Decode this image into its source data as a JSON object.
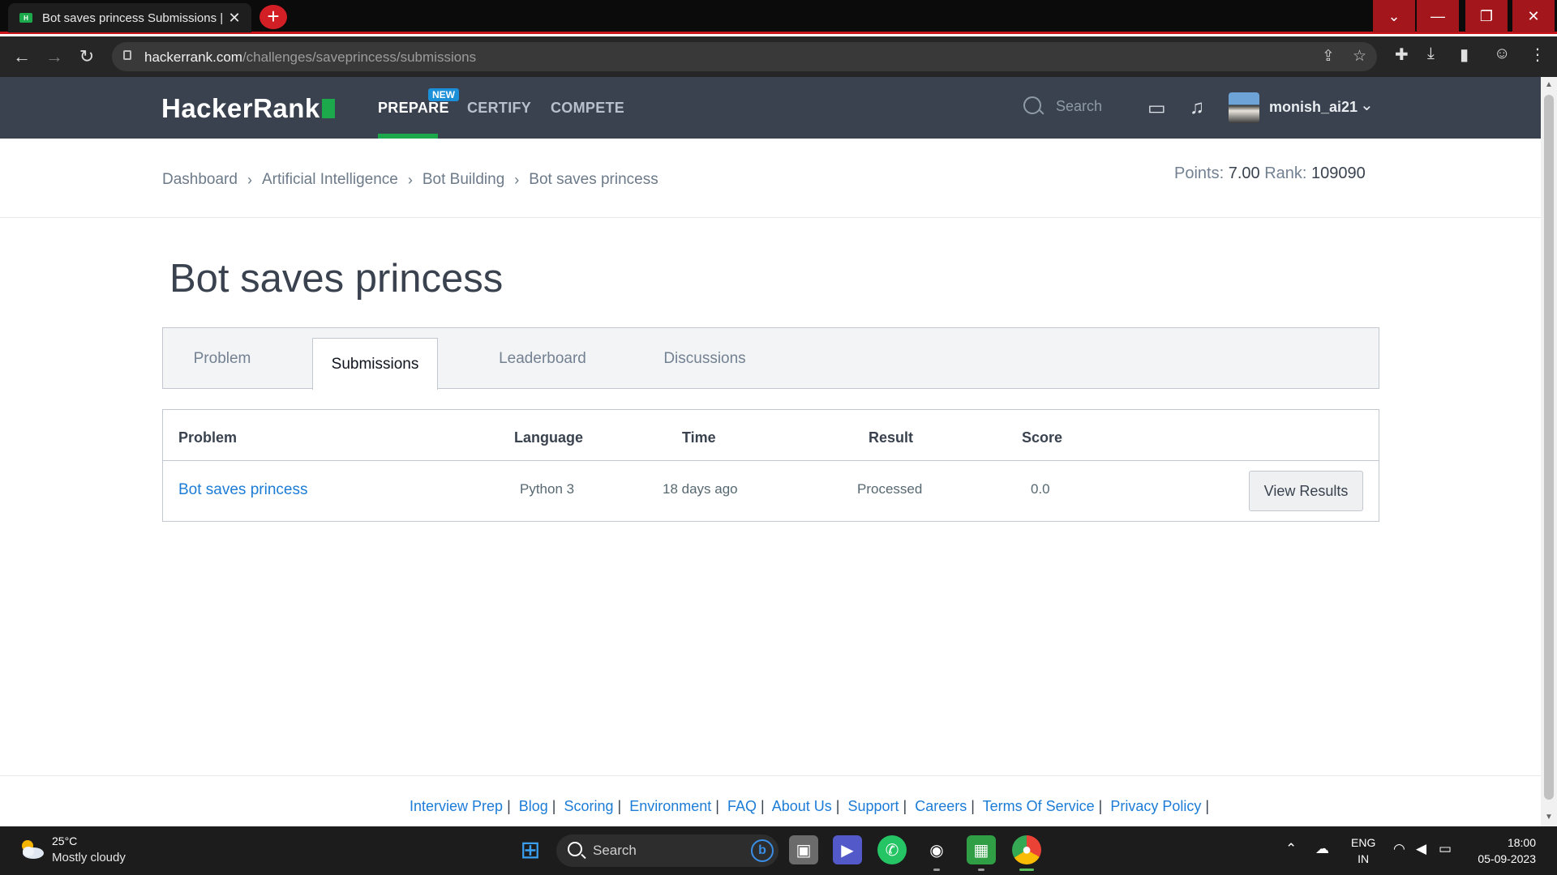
{
  "browser": {
    "tab_title": "Bot saves princess Submissions | HackerRank",
    "new_tab_label": "+",
    "url_host": "hackerrank.com",
    "url_path": "/challenges/saveprincess/submissions"
  },
  "hr_nav": {
    "logo": "HackerRank",
    "links": [
      "PREPARE",
      "CERTIFY",
      "COMPETE"
    ],
    "new_badge": "NEW",
    "search_placeholder": "Search",
    "username": "monish_ai21"
  },
  "breadcrumb": [
    "Dashboard",
    "Artificial Intelligence",
    "Bot Building",
    "Bot saves princess"
  ],
  "stats": {
    "points_label": "Points:",
    "points_value": "7.00",
    "rank_label": "Rank:",
    "rank_value": "109090"
  },
  "page_title": "Bot saves princess",
  "tabs": [
    "Problem",
    "Submissions",
    "Leaderboard",
    "Discussions"
  ],
  "active_tab": "Submissions",
  "table": {
    "headers": [
      "Problem",
      "Language",
      "Time",
      "Result",
      "Score"
    ],
    "rows": [
      {
        "problem": "Bot saves princess",
        "language": "Python 3",
        "time": "18 days ago",
        "result": "Processed",
        "score": "0.0",
        "action": "View Results"
      }
    ]
  },
  "footer_links": [
    "Interview Prep",
    "Blog",
    "Scoring",
    "Environment",
    "FAQ",
    "About Us",
    "Support",
    "Careers",
    "Terms Of Service",
    "Privacy Policy"
  ],
  "taskbar": {
    "weather_temp": "25°C",
    "weather_desc": "Mostly cloudy",
    "search_label": "Search",
    "lang_line1": "ENG",
    "lang_line2": "IN",
    "time": "18:00",
    "date": "05-09-2023"
  },
  "colors": {
    "hr_nav_bg": "#39424e",
    "hr_green": "#1ba94c",
    "link_blue": "#1c7cd6",
    "browser_accent": "#c9161b"
  }
}
